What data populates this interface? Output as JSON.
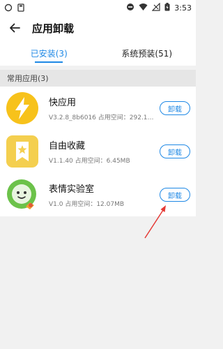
{
  "status_bar": {
    "time": "3:53"
  },
  "header": {
    "title": "应用卸载"
  },
  "tabs": [
    {
      "label": "已安装(3)",
      "active": true
    },
    {
      "label": "系统预装(51)",
      "active": false
    }
  ],
  "section": {
    "title": "常用应用(3)"
  },
  "apps": [
    {
      "name": "快应用",
      "meta": "V3.2.8_8b6016   占用空间：292.11...",
      "button": "卸载"
    },
    {
      "name": "自由收藏",
      "meta": "V1.1.40   占用空间：6.45MB",
      "button": "卸载"
    },
    {
      "name": "表情实验室",
      "meta": "V1.0   占用空间：12.07MB",
      "button": "卸载"
    }
  ],
  "colors": {
    "accent": "#1e88e5",
    "arrow": "#e53935"
  }
}
